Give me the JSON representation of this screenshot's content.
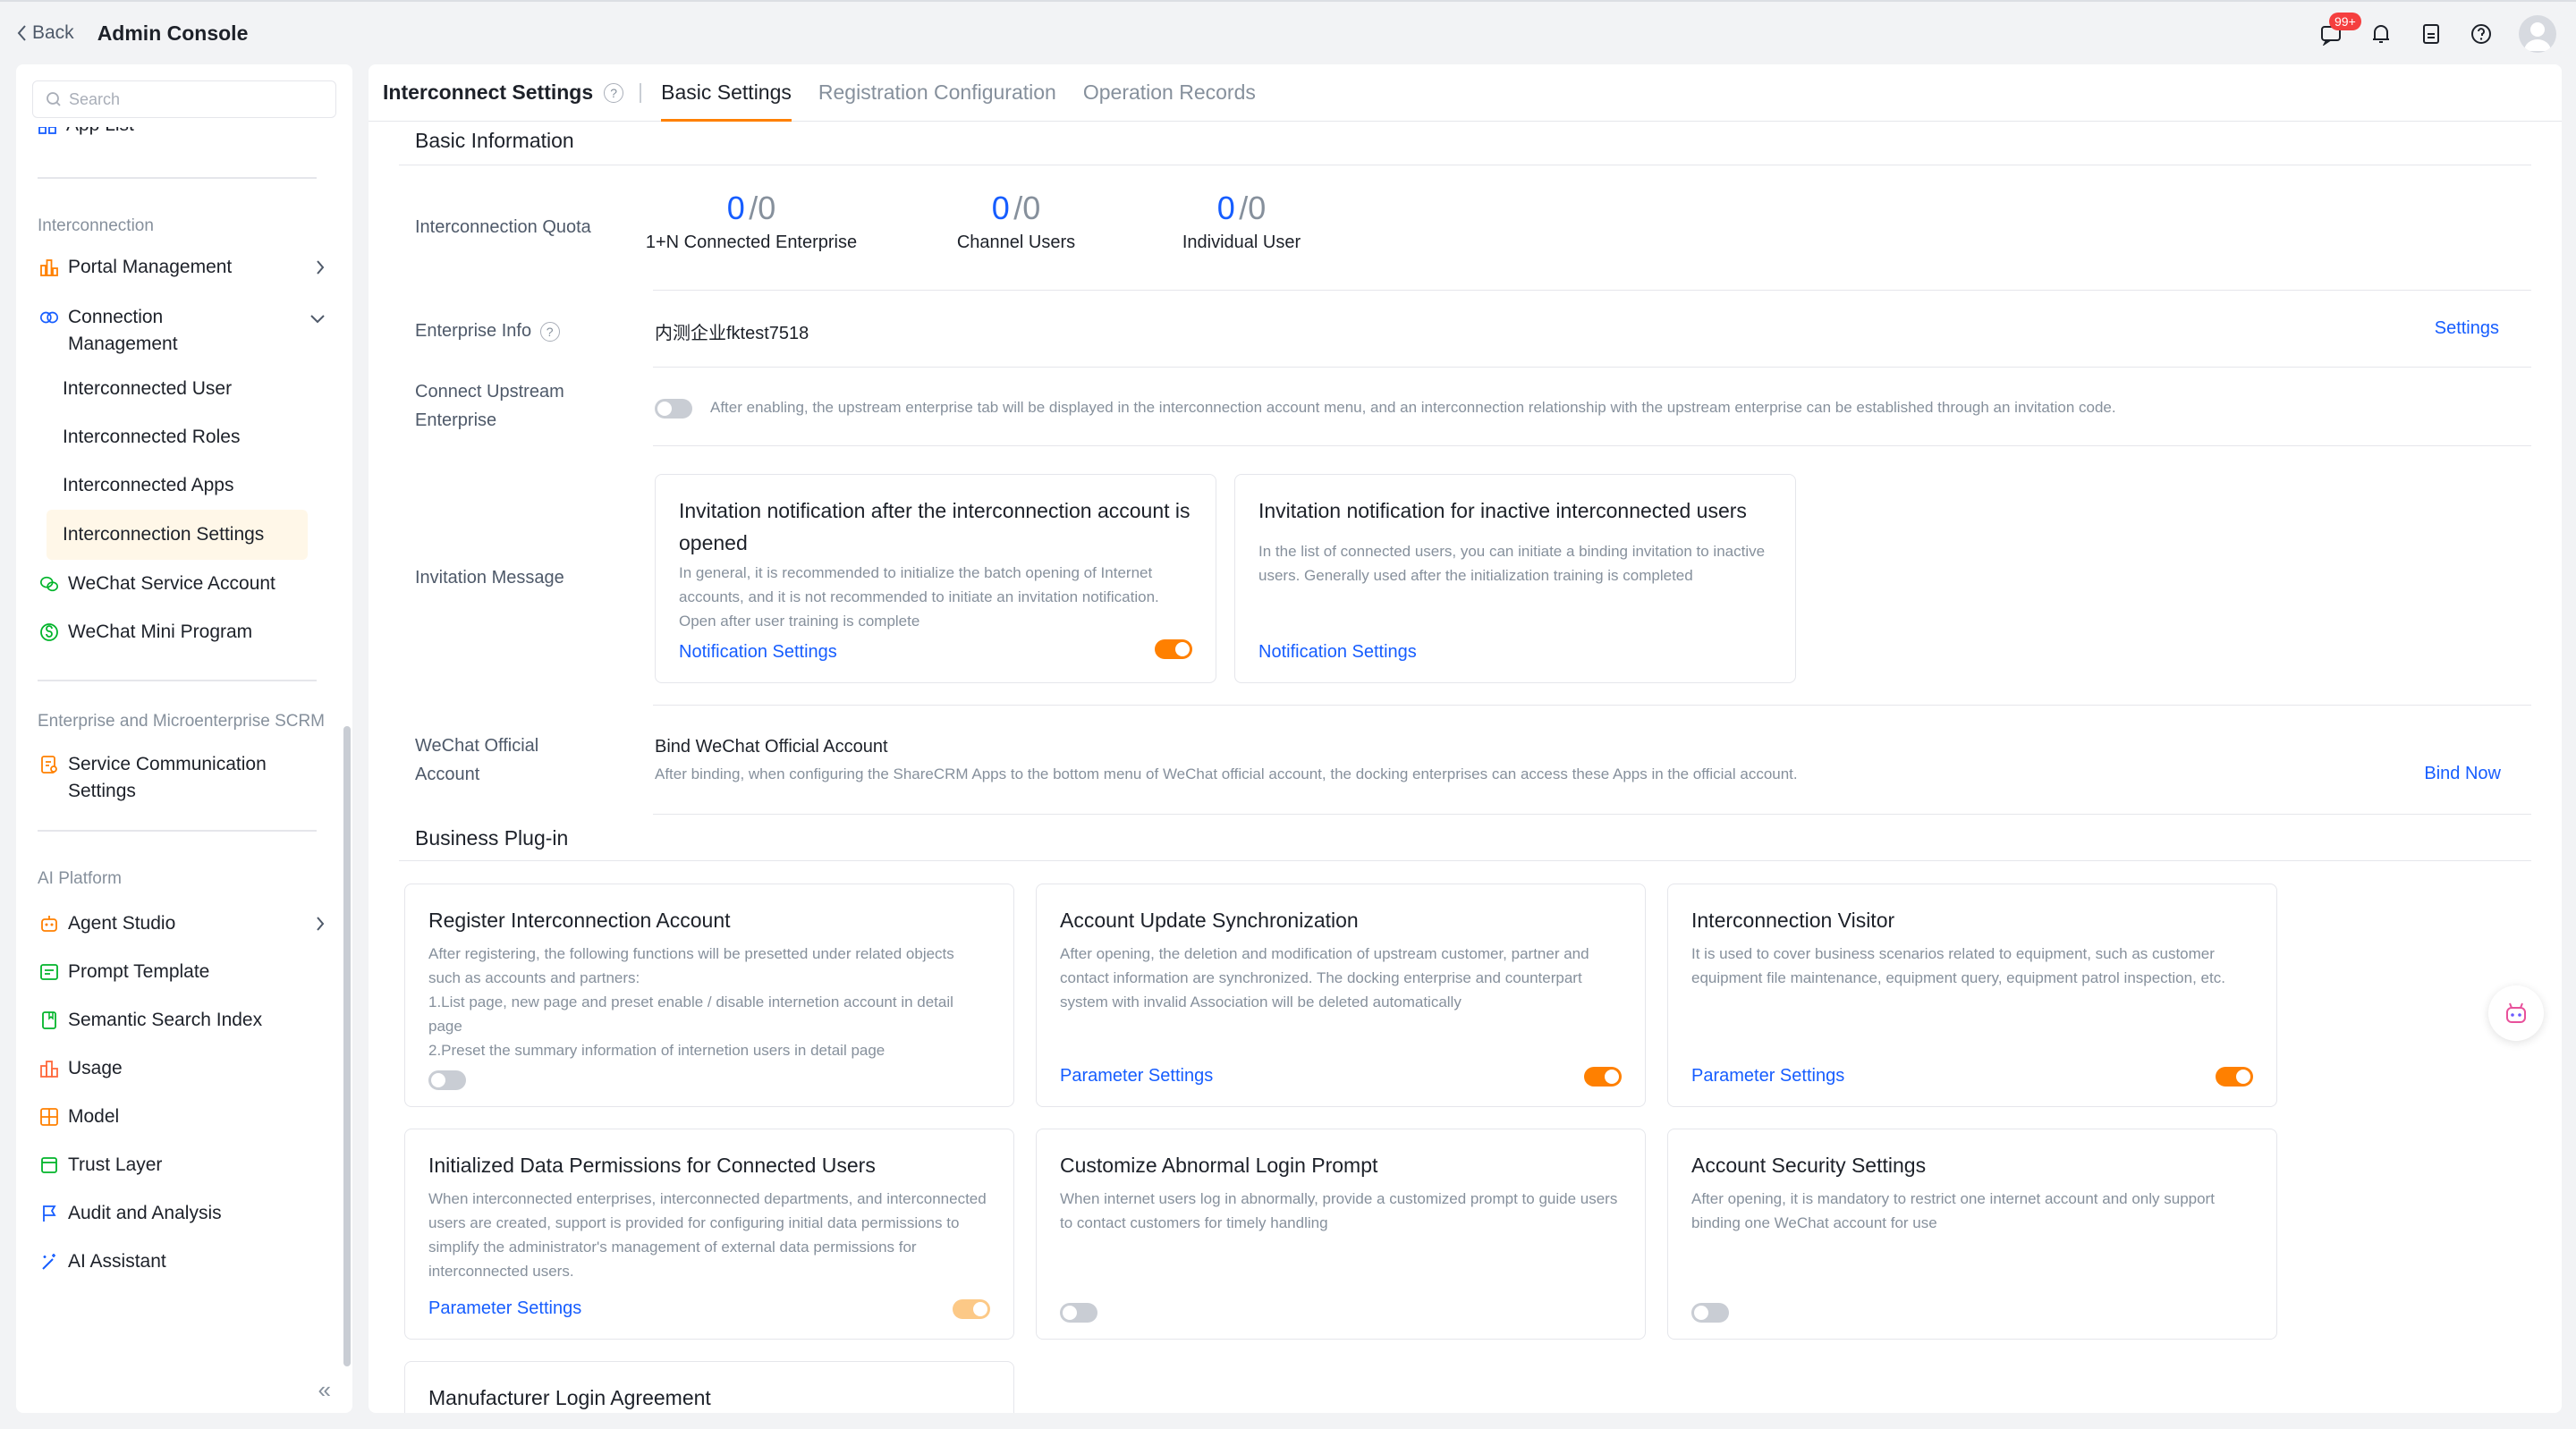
{
  "topbar": {
    "back_label": "Back",
    "title": "Admin Console",
    "notification_badge": "99+"
  },
  "sidebar": {
    "search_placeholder": "Search",
    "app_list_label": "App List",
    "groups": {
      "interconnection": "Interconnection",
      "scrm": "Enterprise and Microenterprise SCRM",
      "ai": "AI Platform"
    },
    "items": {
      "portal_management": "Portal Management",
      "connection_management_1": "Connection",
      "connection_management_2": "Management",
      "interconnected_user": "Interconnected User",
      "interconnected_roles": "Interconnected Roles",
      "interconnected_apps": "Interconnected Apps",
      "interconnection_settings": "Interconnection Settings",
      "wechat_service_account": "WeChat Service Account",
      "wechat_mini_program": "WeChat Mini Program",
      "service_comm_1": "Service Communication",
      "service_comm_2": "Settings",
      "agent_studio": "Agent Studio",
      "prompt_template": "Prompt Template",
      "semantic_search_index": "Semantic Search Index",
      "usage": "Usage",
      "model": "Model",
      "trust_layer": "Trust Layer",
      "audit_analysis": "Audit and Analysis",
      "ai_assistant": "AI Assistant"
    },
    "collapse_glyph": "«"
  },
  "main": {
    "title": "Interconnect Settings",
    "help_glyph": "?",
    "tabs": [
      "Basic Settings",
      "Registration Configuration",
      "Operation Records"
    ],
    "basic_info": {
      "heading": "Basic Information",
      "quota_label": "Interconnection Quota",
      "quotas": [
        {
          "used": "0",
          "total": "/0",
          "caption": "1+N Connected Enterprise"
        },
        {
          "used": "0",
          "total": "/0",
          "caption": "Channel Users"
        },
        {
          "used": "0",
          "total": "/0",
          "caption": "Individual User"
        }
      ],
      "enterprise_info_label": "Enterprise Info",
      "enterprise_name": "内测企业fktest7518",
      "settings_link": "Settings",
      "upstream_label_1": "Connect Upstream",
      "upstream_label_2": "Enterprise",
      "upstream_desc": "After enabling, the upstream enterprise tab will be displayed in the interconnection account menu, and an interconnection relationship with the upstream enterprise can be established through an invitation code.",
      "upstream_enabled": false,
      "invitation_label": "Invitation Message",
      "invite_cards": [
        {
          "title": "Invitation notification after the interconnection account is opened",
          "desc": "In general, it is recommended to initialize the batch opening of Internet accounts, and it is not recommended to initiate an invitation notification. Open after user training is complete",
          "link": "Notification Settings",
          "enabled": true
        },
        {
          "title": "Invitation notification for inactive interconnected users",
          "desc": "In the list of connected users, you can initiate a binding invitation to inactive users. Generally used after the initialization training is completed",
          "link": "Notification Settings"
        }
      ],
      "wechat_label_1": "WeChat Official",
      "wechat_label_2": "Account",
      "wechat_title": "Bind WeChat Official Account",
      "wechat_desc": "After binding, when configuring the ShareCRM Apps to the bottom menu of WeChat official account, the docking enterprises can access these Apps in the official account.",
      "bind_link": "Bind Now"
    },
    "plugins": {
      "heading": "Business Plug-in",
      "cards": [
        {
          "title": "Register Interconnection Account",
          "desc_lines": [
            "After registering, the following functions will be presetted under related objects such as accounts and partners:",
            "1.List page, new page and preset enable / disable internetion account in detail page",
            "2.Preset the summary information of internetion users in detail page"
          ],
          "link": "",
          "state": "off"
        },
        {
          "title": "Account Update Synchronization",
          "desc_lines": [
            "After opening, the deletion and modification of upstream customer, partner and contact information are synchronized. The docking enterprise and counterpart system with invalid Association will be deleted automatically"
          ],
          "link": "Parameter Settings",
          "state": "on"
        },
        {
          "title": "Interconnection Visitor",
          "desc_lines": [
            "It is used to cover business scenarios related to equipment, such as customer equipment file maintenance, equipment query, equipment patrol inspection, etc."
          ],
          "link": "Parameter Settings",
          "state": "on"
        },
        {
          "title": "Initialized Data Permissions for Connected Users",
          "desc_lines": [
            "When interconnected enterprises, interconnected departments, and interconnected users are created, support is provided for configuring initial data permissions to simplify the administrator's management of external data permissions for interconnected users."
          ],
          "link": "Parameter Settings",
          "state": "dim"
        },
        {
          "title": "Customize Abnormal Login Prompt",
          "desc_lines": [
            "When internet users log in abnormally, provide a customized prompt to guide users to contact customers for timely handling"
          ],
          "link": "",
          "state": "off"
        },
        {
          "title": "Account Security Settings",
          "desc_lines": [
            "After opening, it is mandatory to restrict one internet account and only support binding one WeChat account for use"
          ],
          "link": "",
          "state": "off"
        },
        {
          "title": "Manufacturer Login Agreement",
          "desc_lines": [],
          "link": "",
          "state": ""
        }
      ]
    }
  },
  "colors": {
    "accent": "#ff8000",
    "link": "#165dff",
    "active_bg": "#fff7e8"
  }
}
